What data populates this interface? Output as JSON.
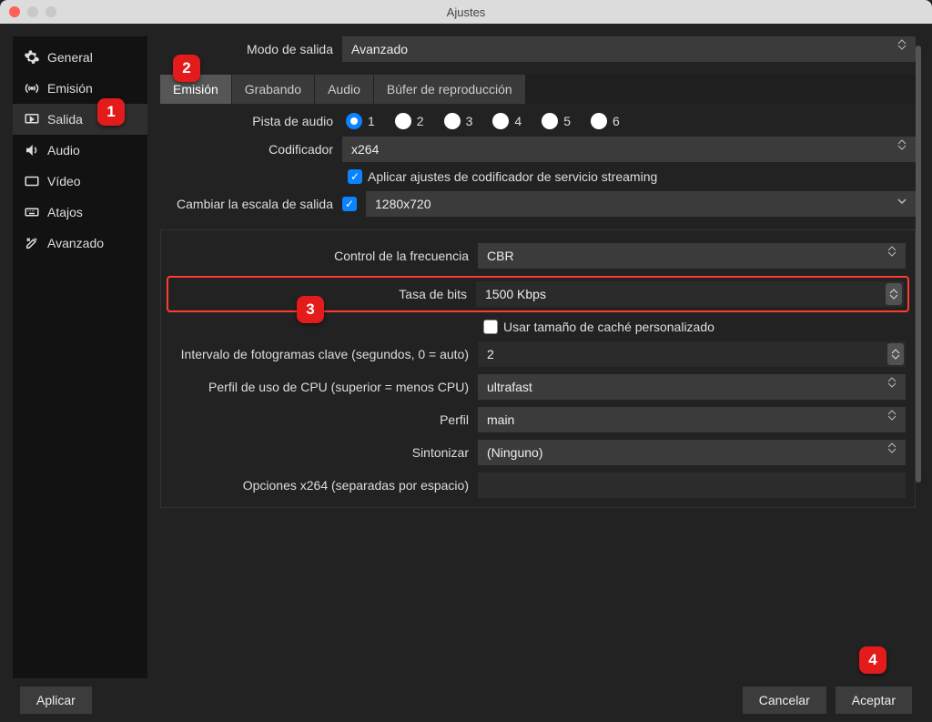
{
  "window": {
    "title": "Ajustes"
  },
  "sidebar": {
    "items": [
      {
        "label": "General"
      },
      {
        "label": "Emisión"
      },
      {
        "label": "Salida"
      },
      {
        "label": "Audio"
      },
      {
        "label": "Vídeo"
      },
      {
        "label": "Atajos"
      },
      {
        "label": "Avanzado"
      }
    ],
    "active_index": 2
  },
  "output_mode": {
    "label": "Modo de salida",
    "value": "Avanzado"
  },
  "tabs": {
    "items": [
      "Emisión",
      "Grabando",
      "Audio",
      "Búfer de reproducción"
    ],
    "active_index": 0
  },
  "audio_track": {
    "label": "Pista de audio",
    "options": [
      "1",
      "2",
      "3",
      "4",
      "5",
      "6"
    ],
    "selected_index": 0
  },
  "encoder": {
    "label": "Codificador",
    "value": "x264"
  },
  "enforce_service": {
    "checked": true,
    "label": "Aplicar ajustes de codificador de servicio streaming"
  },
  "rescale": {
    "label": "Cambiar la escala de salida",
    "checked": true,
    "value": "1280x720"
  },
  "rate_control": {
    "label": "Control de la frecuencia",
    "value": "CBR"
  },
  "bitrate": {
    "label": "Tasa de bits",
    "value": "1500 Kbps"
  },
  "custom_buffer": {
    "checked": false,
    "label": "Usar tamaño de caché personalizado"
  },
  "keyframe": {
    "label": "Intervalo de fotogramas clave (segundos, 0 = auto)",
    "value": "2"
  },
  "cpu_preset": {
    "label": "Perfil de uso de CPU (superior = menos CPU)",
    "value": "ultrafast"
  },
  "profile": {
    "label": "Perfil",
    "value": "main"
  },
  "tune": {
    "label": "Sintonizar",
    "value": "(Ninguno)"
  },
  "x264opts": {
    "label": "Opciones x264 (separadas por espacio)",
    "value": ""
  },
  "buttons": {
    "apply": "Aplicar",
    "cancel": "Cancelar",
    "ok": "Aceptar"
  },
  "callouts": {
    "c1": "1",
    "c2": "2",
    "c3": "3",
    "c4": "4"
  }
}
